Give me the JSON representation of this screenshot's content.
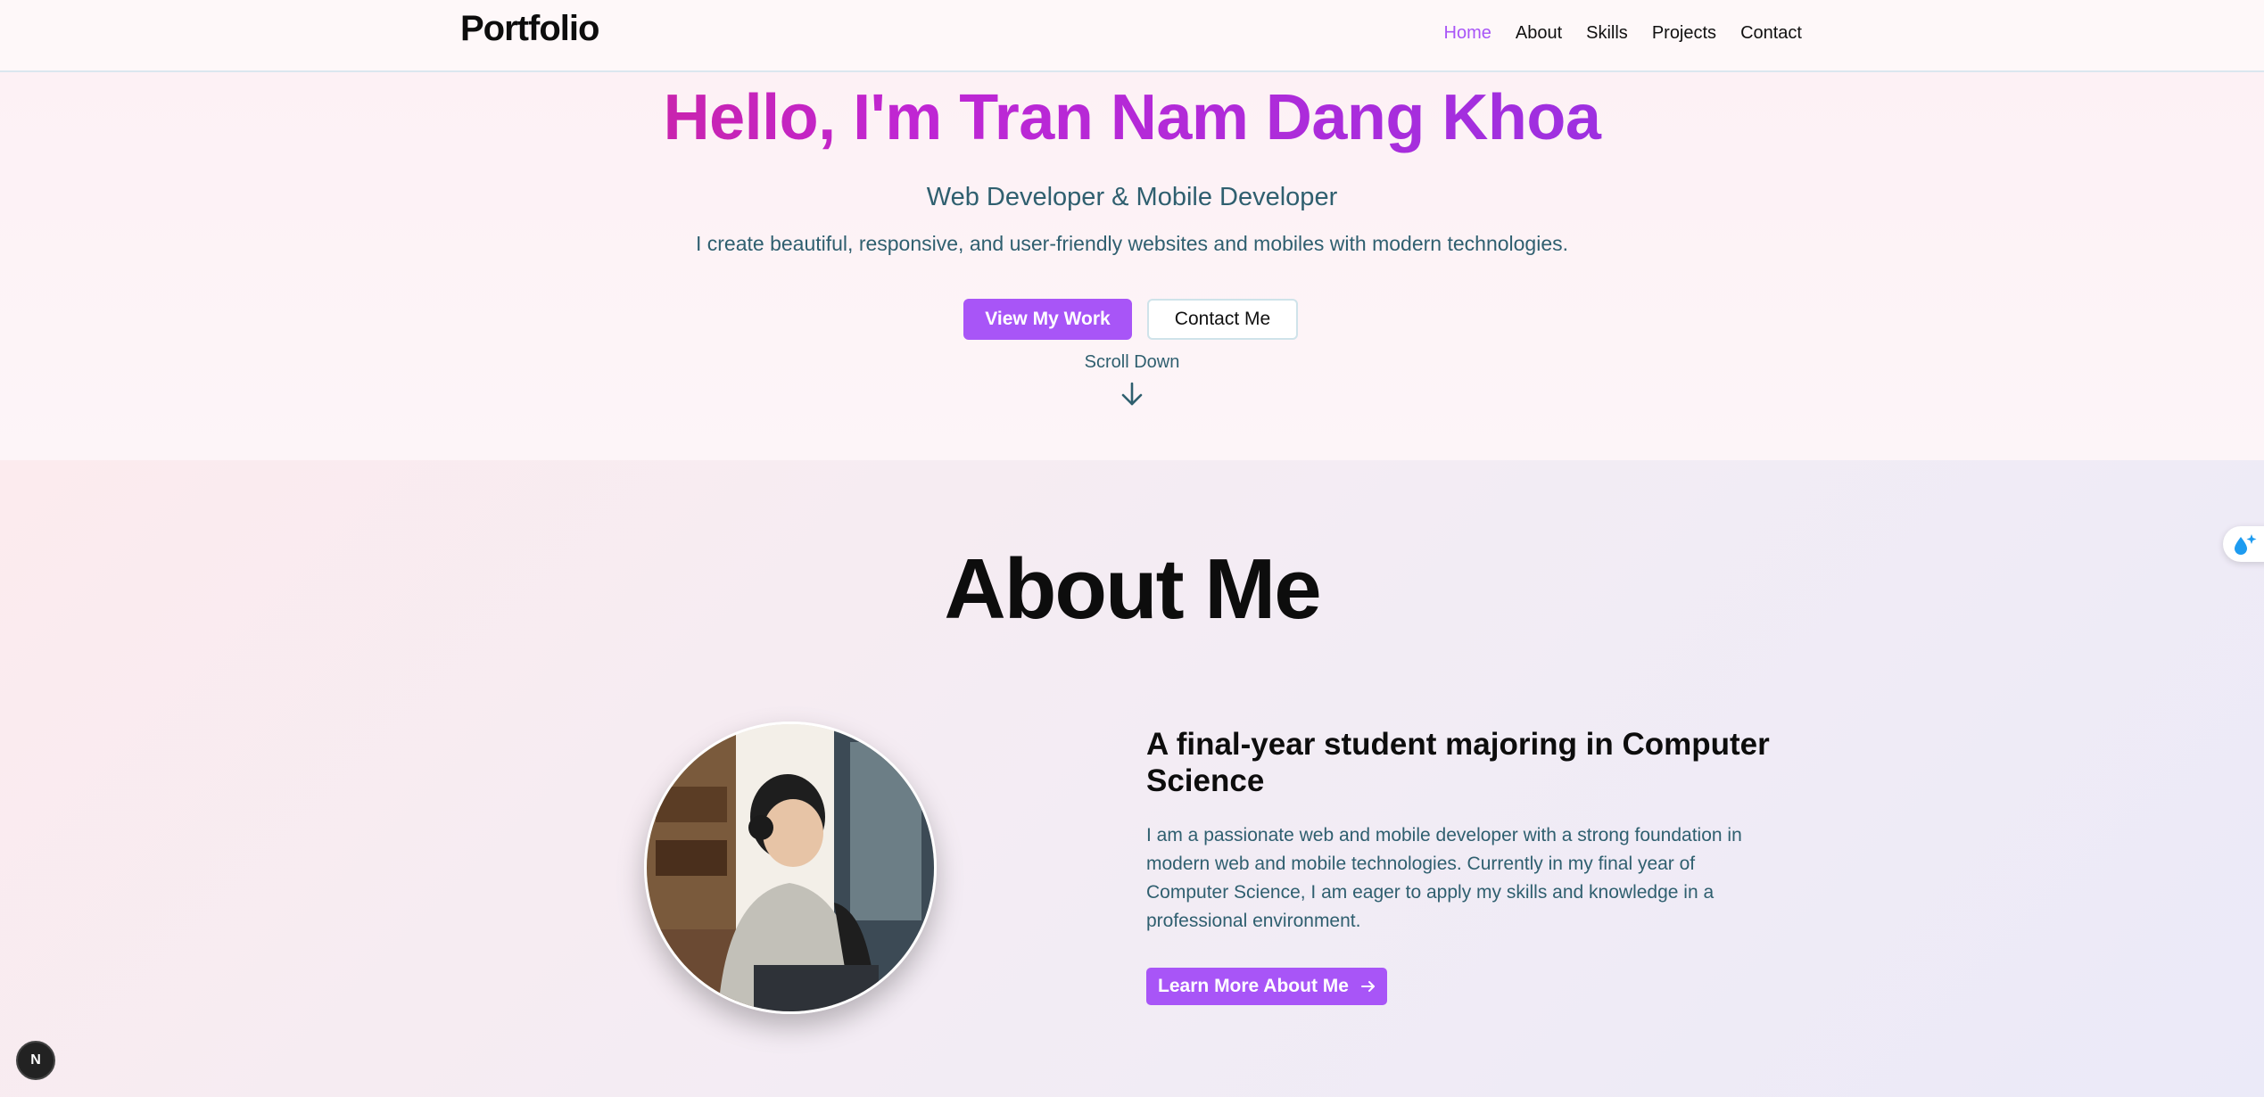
{
  "nav": {
    "logo": "Portfolio",
    "links": [
      "Home",
      "About",
      "Skills",
      "Projects",
      "Contact"
    ],
    "active": "Home"
  },
  "hero": {
    "title": "Hello, I'm Tran Nam Dang Khoa",
    "subtitle": "Web Developer & Mobile Developer",
    "description": "I create beautiful, responsive, and user-friendly websites and mobiles with modern technologies.",
    "primary_button": "View My Work",
    "secondary_button": "Contact Me",
    "scroll_label": "Scroll Down"
  },
  "about": {
    "title": "About Me",
    "heading": "A final-year student majoring in Computer Science",
    "text": "I am a passionate web and mobile developer with a strong foundation in modern web and mobile technologies. Currently in my final year of Computer Science, I am eager to apply my skills and knowledge in a professional environment.",
    "button": "Learn More About Me"
  },
  "badge": {
    "label": "N"
  },
  "colors": {
    "accent": "#a855f7",
    "text_muted": "#2f5f6f",
    "gradient_start": "#e11d48",
    "gradient_end": "#7c3aed"
  }
}
